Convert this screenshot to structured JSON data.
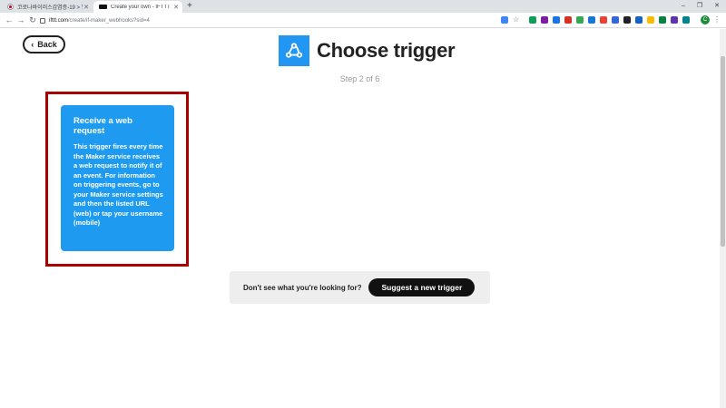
{
  "browser": {
    "tabs": [
      {
        "title": "코로나바이러스감염증-19 > 발",
        "active": false
      },
      {
        "title": "Create your own - IFTTT",
        "active": true
      }
    ],
    "url_host": "ifttt.com",
    "url_path": "/create/if-maker_webhooks?sid=4",
    "new_tab": "+",
    "window_controls": [
      "–",
      "❐",
      "✕"
    ],
    "profile_initial": "C"
  },
  "page": {
    "back_label": "Back",
    "title": "Choose trigger",
    "step": "Step 2 of 6",
    "trigger": {
      "title": "Receive a web request",
      "description": "This trigger fires every time the Maker service receives a web request to notify it of an event. For information on triggering events, go to your Maker service settings and then the listed URL (web) or tap your username (mobile)"
    },
    "suggest": {
      "question": "Don't see what you're looking for?",
      "button": "Suggest a new trigger"
    }
  },
  "colors": {
    "service_blue": "#2196f3",
    "card_blue": "#1e9bf0",
    "highlight_red": "#a90000"
  }
}
